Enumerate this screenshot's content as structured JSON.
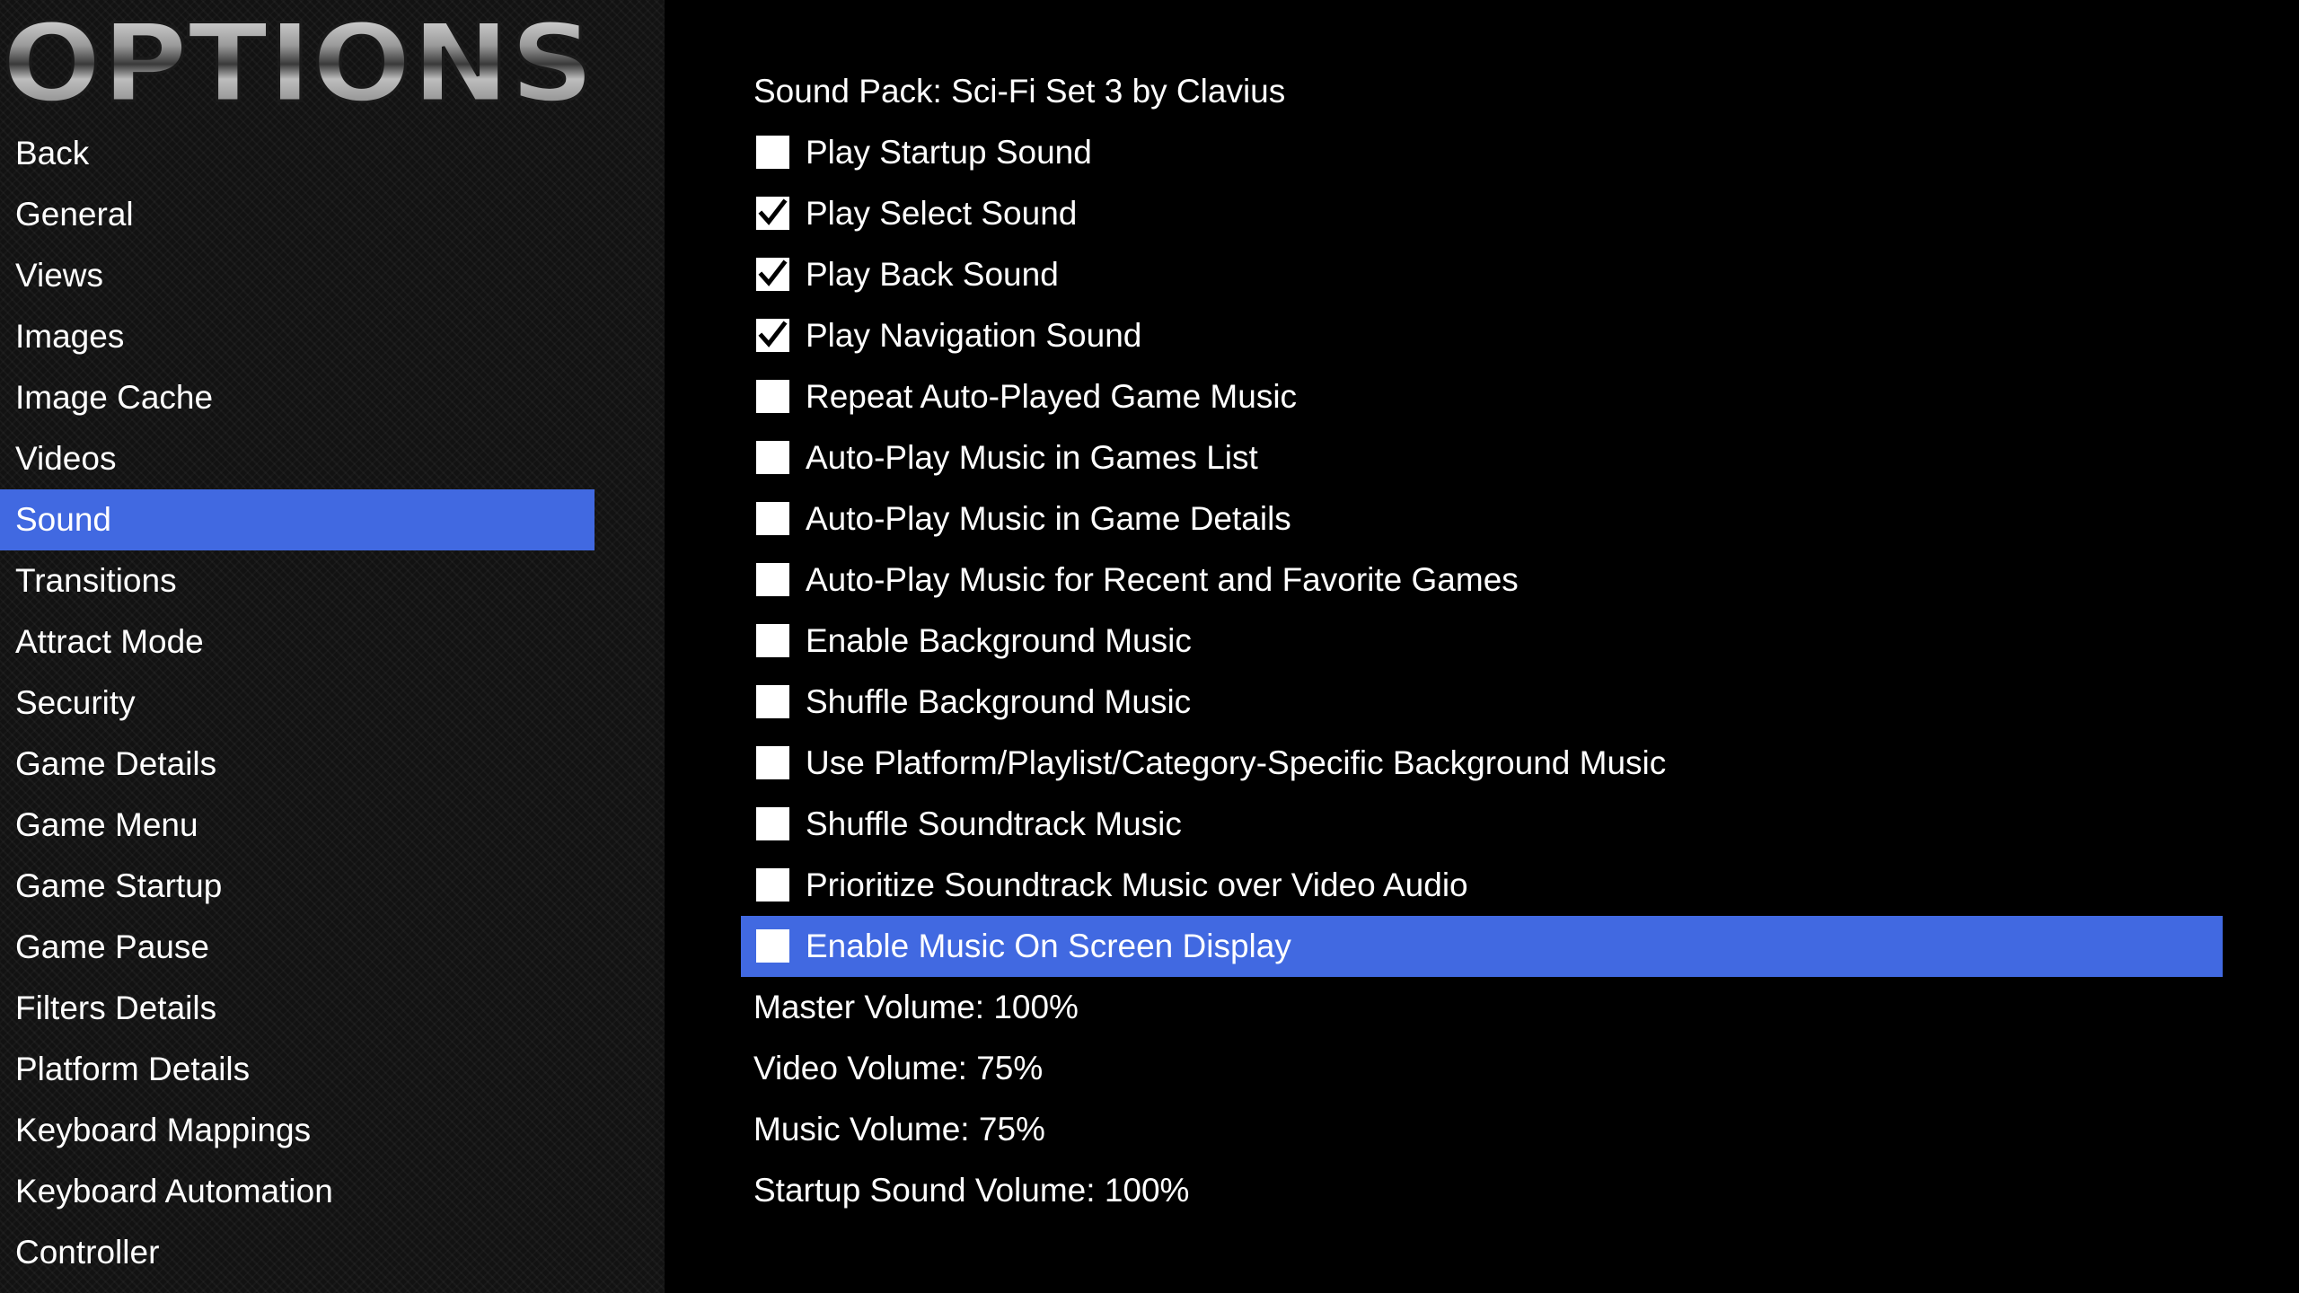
{
  "app": {
    "logo_text": "OPTIONS",
    "accent_color": "#4169e1"
  },
  "sidebar": {
    "items": [
      {
        "label": "Back",
        "selected": false
      },
      {
        "label": "General",
        "selected": false
      },
      {
        "label": "Views",
        "selected": false
      },
      {
        "label": "Images",
        "selected": false
      },
      {
        "label": "Image Cache",
        "selected": false
      },
      {
        "label": "Videos",
        "selected": false
      },
      {
        "label": "Sound",
        "selected": true
      },
      {
        "label": "Transitions",
        "selected": false
      },
      {
        "label": "Attract Mode",
        "selected": false
      },
      {
        "label": "Security",
        "selected": false
      },
      {
        "label": "Game Details",
        "selected": false
      },
      {
        "label": "Game Menu",
        "selected": false
      },
      {
        "label": "Game Startup",
        "selected": false
      },
      {
        "label": "Game Pause",
        "selected": false
      },
      {
        "label": "Filters Details",
        "selected": false
      },
      {
        "label": "Platform Details",
        "selected": false
      },
      {
        "label": "Keyboard Mappings",
        "selected": false
      },
      {
        "label": "Keyboard Automation",
        "selected": false
      },
      {
        "label": "Controller",
        "selected": false
      }
    ]
  },
  "main": {
    "sound_pack": "Sound Pack: Sci-Fi Set 3 by Clavius",
    "options": [
      {
        "label": "Play Startup Sound",
        "checked": false,
        "selected": false
      },
      {
        "label": "Play Select Sound",
        "checked": true,
        "selected": false
      },
      {
        "label": "Play Back Sound",
        "checked": true,
        "selected": false
      },
      {
        "label": "Play Navigation Sound",
        "checked": true,
        "selected": false
      },
      {
        "label": "Repeat Auto-Played Game Music",
        "checked": false,
        "selected": false
      },
      {
        "label": "Auto-Play Music in Games List",
        "checked": false,
        "selected": false
      },
      {
        "label": "Auto-Play Music in Game Details",
        "checked": false,
        "selected": false
      },
      {
        "label": "Auto-Play Music for Recent and Favorite Games",
        "checked": false,
        "selected": false
      },
      {
        "label": "Enable Background Music",
        "checked": false,
        "selected": false
      },
      {
        "label": "Shuffle Background Music",
        "checked": false,
        "selected": false
      },
      {
        "label": "Use Platform/Playlist/Category-Specific Background Music",
        "checked": false,
        "selected": false
      },
      {
        "label": "Shuffle Soundtrack Music",
        "checked": false,
        "selected": false
      },
      {
        "label": "Prioritize Soundtrack Music over Video Audio",
        "checked": false,
        "selected": false
      },
      {
        "label": "Enable Music On Screen Display",
        "checked": false,
        "selected": true
      }
    ],
    "volumes": [
      {
        "label": "Master Volume: 100%",
        "value": 100
      },
      {
        "label": "Video Volume: 75%",
        "value": 75
      },
      {
        "label": "Music Volume: 75%",
        "value": 75
      },
      {
        "label": "Startup Sound Volume: 100%",
        "value": 100
      }
    ]
  }
}
